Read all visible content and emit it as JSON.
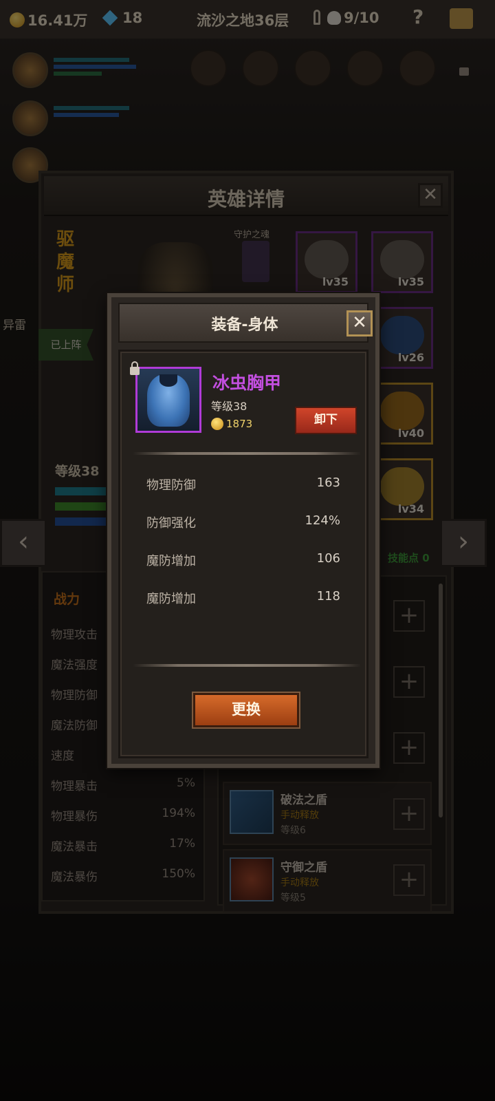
{
  "topbar": {
    "gold": "16.41万",
    "gems": "18",
    "stage": "流沙之地36层",
    "keys": "9/10",
    "help": "?"
  },
  "hero_panel": {
    "title": "英雄详情",
    "close": "✕",
    "hero_name": "驱魔师",
    "guard_label": "守护之魂",
    "onboard_label": "已上阵",
    "side_label": "异雷",
    "level": "等级38",
    "equipment": [
      {
        "slot": "helmet",
        "level": "lv35"
      },
      {
        "slot": "necklace",
        "level": "lv35"
      },
      {
        "slot": "boots",
        "level": "lv26"
      },
      {
        "slot": "ring",
        "level": "lv40"
      },
      {
        "slot": "shield",
        "level": "lv34"
      }
    ],
    "skill_points": "技能点 0",
    "nav": {
      "prev": "‹",
      "next": "›"
    }
  },
  "stats": {
    "title": "战力",
    "rows": [
      {
        "label": "物理攻击",
        "value": ""
      },
      {
        "label": "魔法强度",
        "value": ""
      },
      {
        "label": "物理防御",
        "value": ""
      },
      {
        "label": "魔法防御",
        "value": ""
      },
      {
        "label": "速度",
        "value": ""
      },
      {
        "label": "物理暴击",
        "value": "5%"
      },
      {
        "label": "物理暴伤",
        "value": "194%"
      },
      {
        "label": "魔法暴击",
        "value": "17%"
      },
      {
        "label": "魔法暴伤",
        "value": "150%"
      }
    ]
  },
  "skills": [
    {
      "name": "破法之盾",
      "type": "手动释放",
      "level": "等级6"
    },
    {
      "name": "守御之盾",
      "type": "手动释放",
      "level": "等级5"
    }
  ],
  "modal": {
    "title": "装备-身体",
    "close": "✕",
    "item": {
      "name": "冰虫胸甲",
      "level": "等级38",
      "price": "1873",
      "unequip_label": "卸下"
    },
    "attributes": [
      {
        "label": "物理防御",
        "value": "163"
      },
      {
        "label": "防御强化",
        "value": "124%"
      },
      {
        "label": "魔防增加",
        "value": "106"
      },
      {
        "label": "魔防增加",
        "value": "118"
      }
    ],
    "swap_label": "更换"
  },
  "colors": {
    "item_rarity": "#c34fe0",
    "accent_orange": "#d66a2a",
    "unequip_red": "#d0452a",
    "hero_name_gold": "#d99a1b"
  }
}
